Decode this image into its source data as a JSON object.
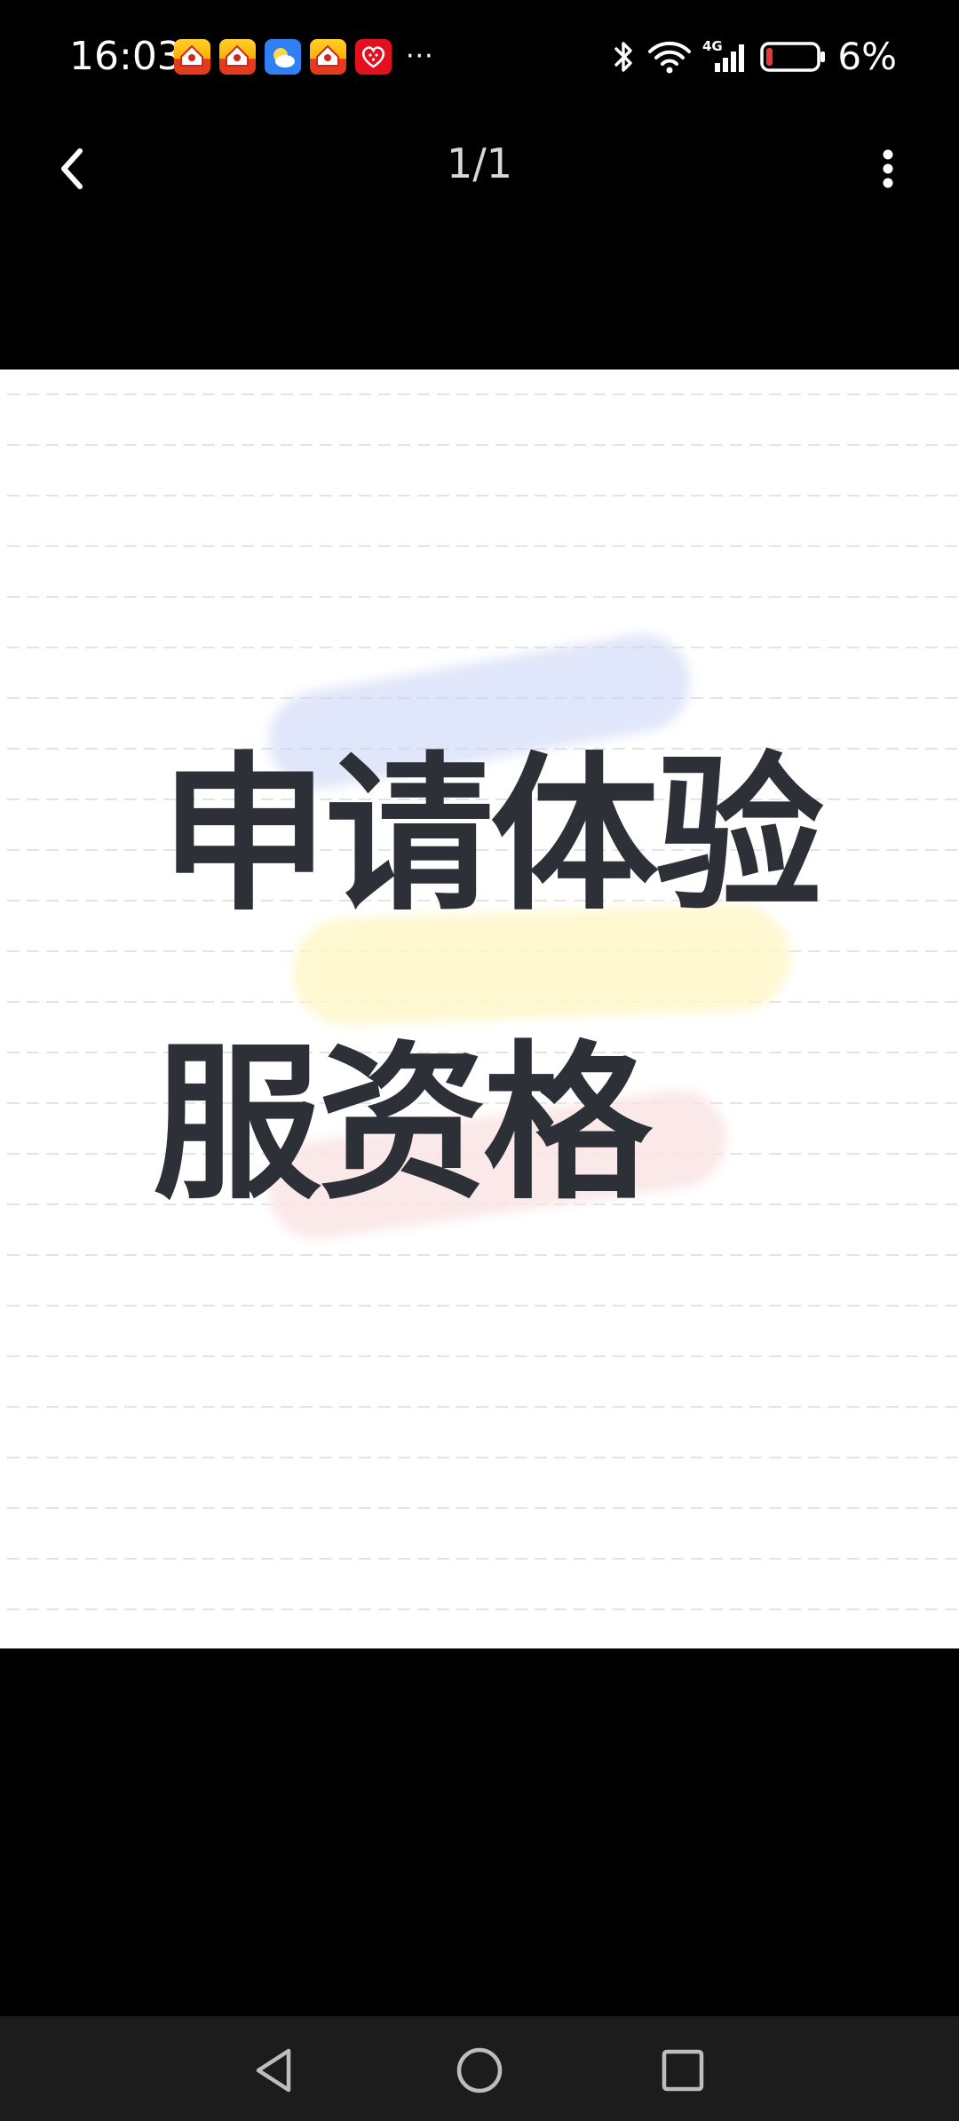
{
  "status_bar": {
    "time": "16:03",
    "notification_icons": [
      "house-app-icon",
      "house-app-icon",
      "weather-app-icon",
      "house-app-icon",
      "heart-app-icon"
    ],
    "more_notifications": "···",
    "system_icons": [
      "bluetooth-icon",
      "wifi-icon",
      "4g-signal-icon",
      "battery-icon"
    ],
    "network_type": "4G",
    "battery_percent": "6%",
    "battery_level": 0.06,
    "battery_color": "#e53935"
  },
  "toolbar": {
    "page_counter": "1/1",
    "back_icon": "chevron-left-icon",
    "more_icon": "more-vertical-icon"
  },
  "image": {
    "line_1": "申请体验",
    "line_2": "服资格",
    "text_color": "#2e3038",
    "highlight_colors": [
      "#c8d4f5",
      "#fff7c8",
      "#fae4e4"
    ]
  },
  "nav_bar": {
    "back_icon": "triangle-back-icon",
    "home_icon": "circle-home-icon",
    "recents_icon": "square-recents-icon"
  }
}
